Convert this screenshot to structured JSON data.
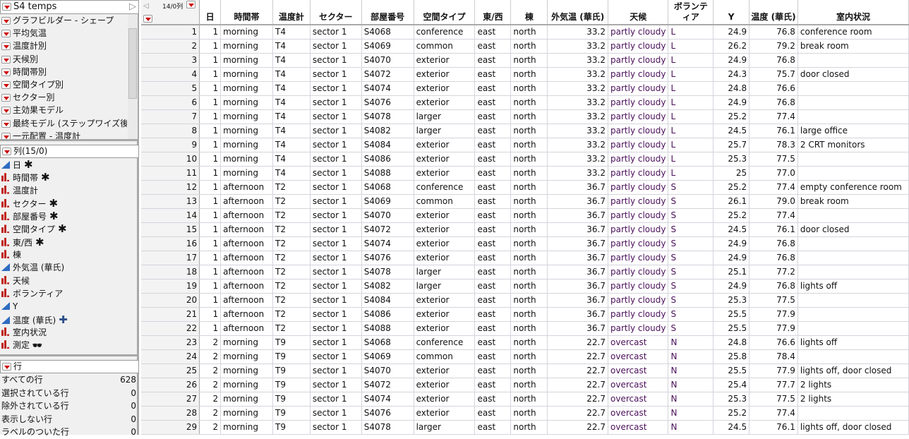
{
  "table_name": "S4 temps",
  "scripts": [
    "グラフビルダー - シェープ",
    "平均気温",
    "温度計別",
    "天候別",
    "時間帯別",
    "空間タイプ別",
    "セクター別",
    "主効果モデル",
    "最終モデル (ステップワイズ後",
    "一元配置 - 温度計"
  ],
  "columns_header": "列(15/0)",
  "columns": [
    {
      "name": "日",
      "type": "continuous",
      "flag": "✱"
    },
    {
      "name": "時間帯",
      "type": "nominal",
      "flag": "✱"
    },
    {
      "name": "温度計",
      "type": "nominal",
      "flag": ""
    },
    {
      "name": "セクター",
      "type": "nominal",
      "flag": "✱"
    },
    {
      "name": "部屋番号",
      "type": "nominal",
      "flag": "✱"
    },
    {
      "name": "空間タイプ",
      "type": "nominal",
      "flag": "✱"
    },
    {
      "name": "東/西",
      "type": "nominal",
      "flag": "✱"
    },
    {
      "name": "棟",
      "type": "nominal",
      "flag": ""
    },
    {
      "name": "外気温 (華氏)",
      "type": "continuous",
      "flag": ""
    },
    {
      "name": "天候",
      "type": "nominal",
      "flag": ""
    },
    {
      "name": "ボランティア",
      "type": "nominal",
      "flag": ""
    },
    {
      "name": "Y",
      "type": "continuous",
      "flag": ""
    },
    {
      "name": "温度 (華氏)",
      "type": "continuous",
      "flag": "✚"
    },
    {
      "name": "室内状況",
      "type": "nominal",
      "flag": ""
    },
    {
      "name": "測定",
      "type": "nominal",
      "flag": "🕶"
    }
  ],
  "rows_header": "行",
  "row_stats": [
    {
      "label": "すべての行",
      "value": "628"
    },
    {
      "label": "選択されている行",
      "value": "0"
    },
    {
      "label": "除外されている行",
      "value": "0"
    },
    {
      "label": "表示しない行",
      "value": "0"
    },
    {
      "label": "ラベルのついた行",
      "value": "0"
    }
  ],
  "grid": {
    "corner_label": "14/0列",
    "headers": [
      "日",
      "時間帯",
      "温度計",
      "セクター",
      "部屋番号",
      "空間タイプ",
      "東/西",
      "棟",
      "外気温 (華氏)",
      "天候",
      "ボランティア",
      "Y",
      "温度 (華氏)",
      "室内状況"
    ],
    "rows": [
      [
        "1",
        "1",
        "morning",
        "T4",
        "sector 1",
        "S4068",
        "conference",
        "east",
        "north",
        "33.2",
        "partly cloudy",
        "L",
        "24.9",
        "76.8",
        "conference room"
      ],
      [
        "2",
        "1",
        "morning",
        "T4",
        "sector 1",
        "S4069",
        "common",
        "east",
        "north",
        "33.2",
        "partly cloudy",
        "L",
        "26.2",
        "79.2",
        "break room"
      ],
      [
        "3",
        "1",
        "morning",
        "T4",
        "sector 1",
        "S4070",
        "exterior",
        "east",
        "north",
        "33.2",
        "partly cloudy",
        "L",
        "24.9",
        "76.8",
        ""
      ],
      [
        "4",
        "1",
        "morning",
        "T4",
        "sector 1",
        "S4072",
        "exterior",
        "east",
        "north",
        "33.2",
        "partly cloudy",
        "L",
        "24.3",
        "75.7",
        "door closed"
      ],
      [
        "5",
        "1",
        "morning",
        "T4",
        "sector 1",
        "S4074",
        "exterior",
        "east",
        "north",
        "33.2",
        "partly cloudy",
        "L",
        "24.8",
        "76.6",
        ""
      ],
      [
        "6",
        "1",
        "morning",
        "T4",
        "sector 1",
        "S4076",
        "exterior",
        "east",
        "north",
        "33.2",
        "partly cloudy",
        "L",
        "24.9",
        "76.8",
        ""
      ],
      [
        "7",
        "1",
        "morning",
        "T4",
        "sector 1",
        "S4078",
        "larger",
        "east",
        "north",
        "33.2",
        "partly cloudy",
        "L",
        "25.2",
        "77.4",
        ""
      ],
      [
        "8",
        "1",
        "morning",
        "T4",
        "sector 1",
        "S4082",
        "larger",
        "east",
        "north",
        "33.2",
        "partly cloudy",
        "L",
        "24.5",
        "76.1",
        "large office"
      ],
      [
        "9",
        "1",
        "morning",
        "T4",
        "sector 1",
        "S4084",
        "exterior",
        "east",
        "north",
        "33.2",
        "partly cloudy",
        "L",
        "25.7",
        "78.3",
        "2 CRT monitors"
      ],
      [
        "10",
        "1",
        "morning",
        "T4",
        "sector 1",
        "S4086",
        "exterior",
        "east",
        "north",
        "33.2",
        "partly cloudy",
        "L",
        "25.3",
        "77.5",
        ""
      ],
      [
        "11",
        "1",
        "morning",
        "T4",
        "sector 1",
        "S4088",
        "exterior",
        "east",
        "north",
        "33.2",
        "partly cloudy",
        "L",
        "25",
        "77.0",
        ""
      ],
      [
        "12",
        "1",
        "afternoon",
        "T2",
        "sector 1",
        "S4068",
        "conference",
        "east",
        "north",
        "36.7",
        "partly cloudy",
        "S",
        "25.2",
        "77.4",
        "empty conference room"
      ],
      [
        "13",
        "1",
        "afternoon",
        "T2",
        "sector 1",
        "S4069",
        "common",
        "east",
        "north",
        "36.7",
        "partly cloudy",
        "S",
        "26.1",
        "79.0",
        "break room"
      ],
      [
        "14",
        "1",
        "afternoon",
        "T2",
        "sector 1",
        "S4070",
        "exterior",
        "east",
        "north",
        "36.7",
        "partly cloudy",
        "S",
        "25.2",
        "77.4",
        ""
      ],
      [
        "15",
        "1",
        "afternoon",
        "T2",
        "sector 1",
        "S4072",
        "exterior",
        "east",
        "north",
        "36.7",
        "partly cloudy",
        "S",
        "24.5",
        "76.1",
        "door closed"
      ],
      [
        "16",
        "1",
        "afternoon",
        "T2",
        "sector 1",
        "S4074",
        "exterior",
        "east",
        "north",
        "36.7",
        "partly cloudy",
        "S",
        "24.9",
        "76.8",
        ""
      ],
      [
        "17",
        "1",
        "afternoon",
        "T2",
        "sector 1",
        "S4076",
        "exterior",
        "east",
        "north",
        "36.7",
        "partly cloudy",
        "S",
        "24.9",
        "76.8",
        ""
      ],
      [
        "18",
        "1",
        "afternoon",
        "T2",
        "sector 1",
        "S4078",
        "larger",
        "east",
        "north",
        "36.7",
        "partly cloudy",
        "S",
        "25.1",
        "77.2",
        ""
      ],
      [
        "19",
        "1",
        "afternoon",
        "T2",
        "sector 1",
        "S4082",
        "larger",
        "east",
        "north",
        "36.7",
        "partly cloudy",
        "S",
        "24.9",
        "76.8",
        "lights off"
      ],
      [
        "20",
        "1",
        "afternoon",
        "T2",
        "sector 1",
        "S4084",
        "exterior",
        "east",
        "north",
        "36.7",
        "partly cloudy",
        "S",
        "25.3",
        "77.5",
        ""
      ],
      [
        "21",
        "1",
        "afternoon",
        "T2",
        "sector 1",
        "S4086",
        "exterior",
        "east",
        "north",
        "36.7",
        "partly cloudy",
        "S",
        "25.5",
        "77.9",
        ""
      ],
      [
        "22",
        "1",
        "afternoon",
        "T2",
        "sector 1",
        "S4088",
        "exterior",
        "east",
        "north",
        "36.7",
        "partly cloudy",
        "S",
        "25.5",
        "77.9",
        ""
      ],
      [
        "23",
        "2",
        "morning",
        "T9",
        "sector 1",
        "S4068",
        "conference",
        "east",
        "north",
        "22.7",
        "overcast",
        "N",
        "24.8",
        "76.6",
        "lights off"
      ],
      [
        "24",
        "2",
        "morning",
        "T9",
        "sector 1",
        "S4069",
        "common",
        "east",
        "north",
        "22.7",
        "overcast",
        "N",
        "25.8",
        "78.4",
        ""
      ],
      [
        "25",
        "2",
        "morning",
        "T9",
        "sector 1",
        "S4070",
        "exterior",
        "east",
        "north",
        "22.7",
        "overcast",
        "N",
        "25.5",
        "77.9",
        "lights off, door closed"
      ],
      [
        "26",
        "2",
        "morning",
        "T9",
        "sector 1",
        "S4072",
        "exterior",
        "east",
        "north",
        "22.7",
        "overcast",
        "N",
        "25.4",
        "77.7",
        "2 lights"
      ],
      [
        "27",
        "2",
        "morning",
        "T9",
        "sector 1",
        "S4074",
        "exterior",
        "east",
        "north",
        "22.7",
        "overcast",
        "N",
        "25.3",
        "77.5",
        "2 lights"
      ],
      [
        "28",
        "2",
        "morning",
        "T9",
        "sector 1",
        "S4076",
        "exterior",
        "east",
        "north",
        "22.7",
        "overcast",
        "N",
        "25.2",
        "77.4",
        ""
      ],
      [
        "29",
        "2",
        "morning",
        "T9",
        "sector 1",
        "S4078",
        "larger",
        "east",
        "north",
        "22.7",
        "overcast",
        "N",
        "24.5",
        "76.1",
        "lights off, door closed"
      ]
    ]
  }
}
